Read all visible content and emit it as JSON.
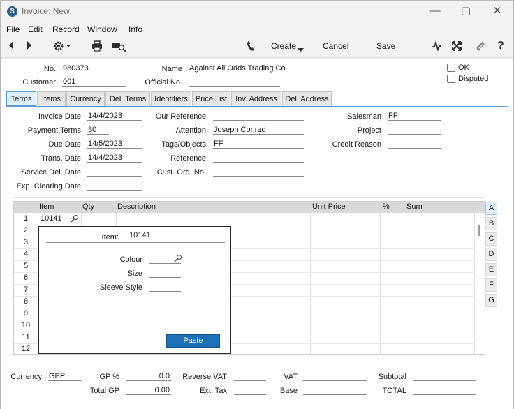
{
  "window": {
    "title": "Invoice: New",
    "app_icon": "S",
    "minimize_icon": "—",
    "maximize_icon": "▢",
    "close_icon": "✕"
  },
  "menu": [
    "File",
    "Edit",
    "Record",
    "Window",
    "Info"
  ],
  "toolbar": {
    "create_label": "Create",
    "cancel_label": "Cancel",
    "save_label": "Save"
  },
  "header": {
    "no_label": "No.",
    "no_value": "980373",
    "name_label": "Name",
    "name_value": "Against All Odds Trading Co",
    "customer_label": "Customer",
    "customer_value": "001",
    "official_no_label": "Official No.",
    "official_no_value": "",
    "ok_label": "OK",
    "disputed_label": "Disputed"
  },
  "tabs": [
    "Terms",
    "Items",
    "Currency",
    "Del. Terms",
    "Identifiers",
    "Price List",
    "Inv. Address",
    "Del. Address"
  ],
  "terms": {
    "invoice_date_label": "Invoice Date",
    "invoice_date": "14/4/2023",
    "payment_terms_label": "Payment Terms",
    "payment_terms": "30",
    "due_date_label": "Due Date",
    "due_date": "14/5/2023",
    "trans_date_label": "Trans. Date",
    "trans_date": "14/4/2023",
    "service_del_date_label": "Service Del. Date",
    "service_del_date": "",
    "exp_clearing_date_label": "Exp. Clearing Date",
    "exp_clearing_date": "",
    "our_reference_label": "Our Reference",
    "our_reference": "",
    "attention_label": "Attention",
    "attention": "Joseph Conrad",
    "tags_label": "Tags/Objects",
    "tags": "FF",
    "reference_label": "Reference",
    "reference": "",
    "cust_ord_no_label": "Cust. Ord. No.",
    "cust_ord_no": "",
    "salesman_label": "Salesman",
    "salesman": "FF",
    "project_label": "Project",
    "project": "",
    "credit_reason_label": "Credit Reason",
    "credit_reason": ""
  },
  "grid": {
    "columns": [
      "Item",
      "Qty",
      "Description",
      "Unit Price",
      "%",
      "Sum"
    ],
    "rows": [
      "1",
      "2",
      "3",
      "4",
      "5",
      "6",
      "7",
      "8",
      "9",
      "10",
      "11",
      "12"
    ],
    "row1_item": "10141",
    "side_tabs": [
      "A",
      "B",
      "C",
      "D",
      "E",
      "F",
      "G"
    ]
  },
  "popup": {
    "item_label": "Item:",
    "item_value": "10141",
    "colour_label": "Colour",
    "size_label": "Size",
    "sleeve_label": "Sleeve Style",
    "paste_label": "Paste"
  },
  "footer": {
    "currency_label": "Currency",
    "currency": "GBP",
    "gp_pct_label": "GP %",
    "gp_pct": "0.0",
    "total_gp_label": "Total GP",
    "total_gp": "0.00",
    "reverse_vat_label": "Reverse VAT",
    "reverse_vat": "",
    "ext_tax_label": "Ext. Tax",
    "ext_tax": "",
    "vat_label": "VAT",
    "vat": "",
    "base_label": "Base",
    "base": "",
    "subtotal_label": "Subtotal",
    "subtotal": "",
    "total_label": "TOTAL",
    "total": ""
  }
}
